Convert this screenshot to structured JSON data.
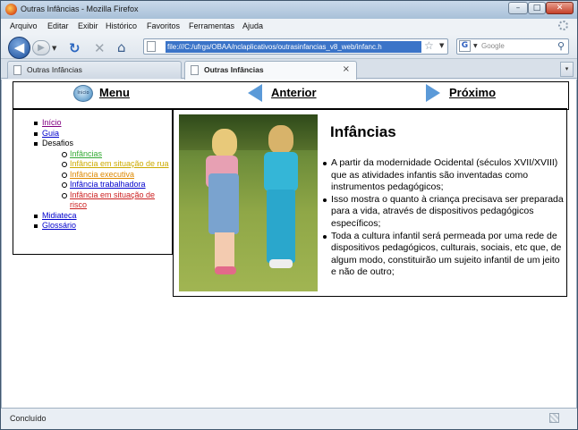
{
  "window": {
    "title": "Outras Infâncias - Mozilla Firefox"
  },
  "menubar": {
    "items": [
      "Arquivo",
      "Editar",
      "Exibir",
      "Histórico",
      "Favoritos",
      "Ferramentas",
      "Ajuda"
    ]
  },
  "navbar": {
    "url": "file:///C:/ufrgs/OBAA/nclaplicativos/outrasinfancias_v8_web/infanc.h",
    "search_placeholder": "Google"
  },
  "tabs": [
    {
      "label": "Outras Infâncias",
      "active": false
    },
    {
      "label": "Outras Infâncias",
      "active": true
    }
  ],
  "page": {
    "nav": {
      "menu": "Menu",
      "previous": "Anterior",
      "next": "Próximo",
      "menu_icon_text": "Inicio"
    },
    "sidebar": {
      "items": [
        {
          "label": "Início",
          "color": "#800080"
        },
        {
          "label": "Guia",
          "color": "#0000cc"
        },
        {
          "label": "Desafios",
          "color": "#000000"
        },
        {
          "label": "Infâncias",
          "color": "#33aa33"
        },
        {
          "label": "Infância em situação de rua",
          "color": "#ccaa00"
        },
        {
          "label": "Infância executiva",
          "color": "#dd8800"
        },
        {
          "label": "Infância trabalhadora",
          "color": "#0000cc"
        },
        {
          "label": "Infância em situação de risco",
          "color": "#cc2222"
        },
        {
          "label": "Midiateca",
          "color": "#0000cc"
        },
        {
          "label": "Glossário",
          "color": "#0000cc"
        }
      ]
    },
    "article": {
      "title": "Infâncias",
      "bullets": [
        "A partir da modernidade Ocidental (séculos XVII/XVIII) que as atividades infantis são inventadas como instrumentos pedagógicos;",
        "Isso mostra o quanto à criança precisava ser preparada para a vida, através de dispositivos pedagógicos específicos;",
        "Toda a cultura infantil será permeada por uma rede de dispositivos pedagógicos, culturais, sociais, etc que, de algum modo, constituirão um sujeito infantil de um jeito e não de outro;"
      ]
    }
  },
  "statusbar": {
    "text": "Concluído"
  }
}
